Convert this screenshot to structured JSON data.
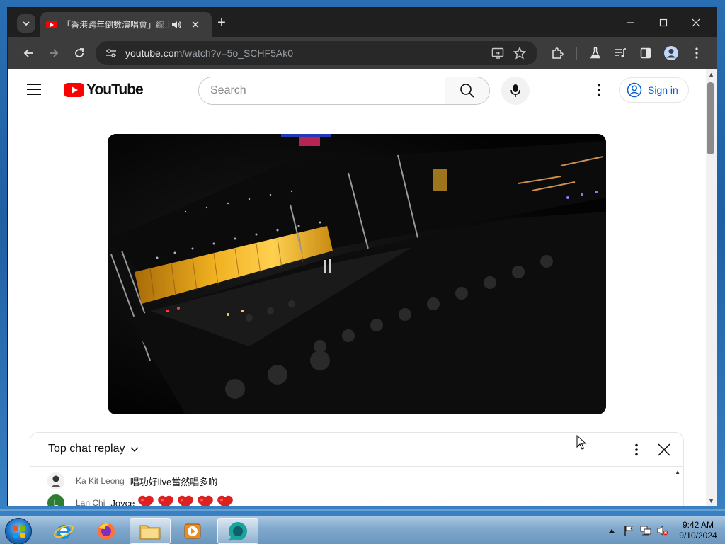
{
  "browser": {
    "tab": {
      "title": "「香港跨年倒數演唱會」線上直播",
      "close": "✕"
    },
    "new_tab": "+",
    "address": {
      "domain": "youtube.com",
      "path": "/watch?v=5o_SCHF5Ak0"
    }
  },
  "youtube": {
    "logo_text": "YouTube",
    "search_placeholder": "Search",
    "signin_label": "Sign in"
  },
  "chat": {
    "title": "Top chat replay",
    "messages": [
      {
        "author": "Ka Kit Leong",
        "text": "唱功好live當然唱多啲",
        "avatar": ""
      },
      {
        "author": "Lan Chi",
        "text": "Joyce",
        "avatar": "L",
        "hearts": 5
      }
    ]
  },
  "taskbar": {
    "time": "9:42 AM",
    "date": "9/10/2024"
  },
  "colors": {
    "youtube_red": "#ff0000",
    "link_blue": "#065fd4",
    "chrome_dark": "#1f1f1f",
    "avatar_green": "#2e7d32"
  }
}
